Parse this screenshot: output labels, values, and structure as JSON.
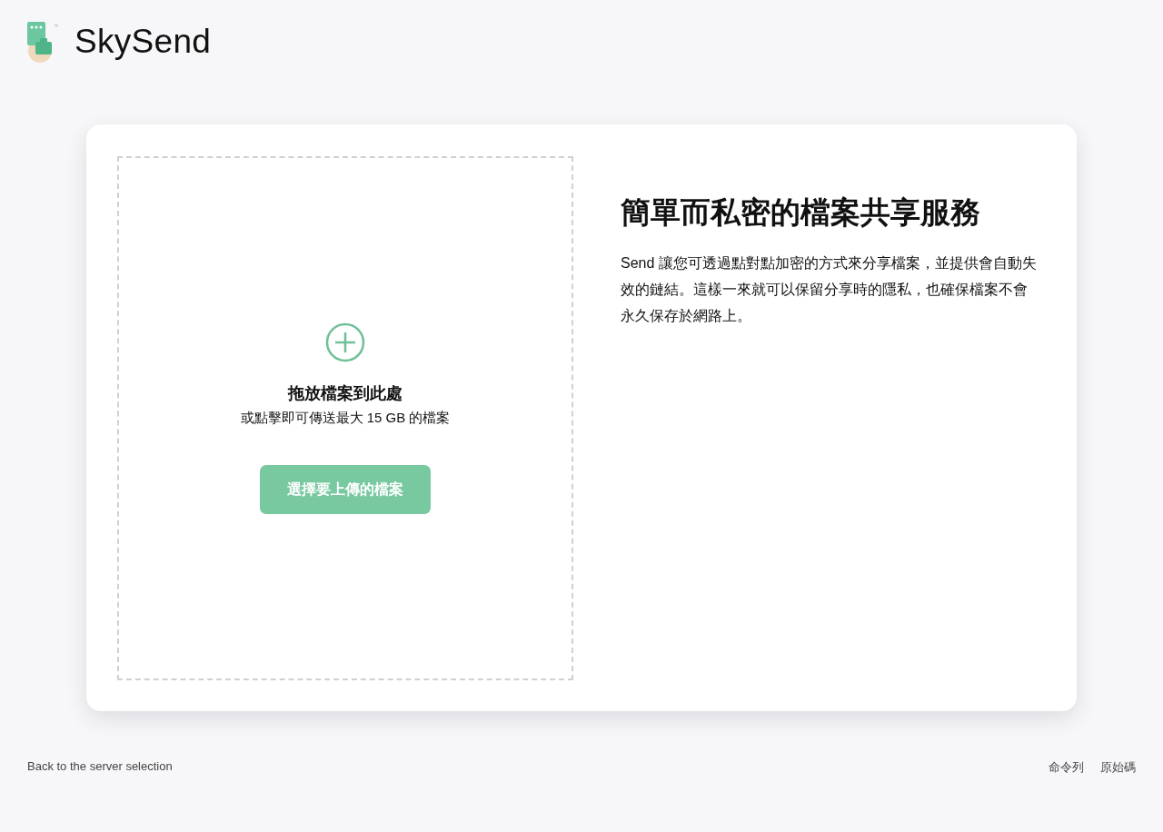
{
  "header": {
    "brand": "SkySend"
  },
  "upload": {
    "title": "拖放檔案到此處",
    "subtitle": "或點擊即可傳送最大 15 GB 的檔案",
    "button": "選擇要上傳的檔案"
  },
  "intro": {
    "heading": "簡單而私密的檔案共享服務",
    "body": "Send 讓您可透過點對點加密的方式來分享檔案，並提供會自動失效的鏈結。這樣一來就可以保留分享時的隱私，也確保檔案不會永久保存於網路上。"
  },
  "footer": {
    "back_link": "Back to the server selection",
    "links": [
      "命令列",
      "原始碼"
    ]
  }
}
